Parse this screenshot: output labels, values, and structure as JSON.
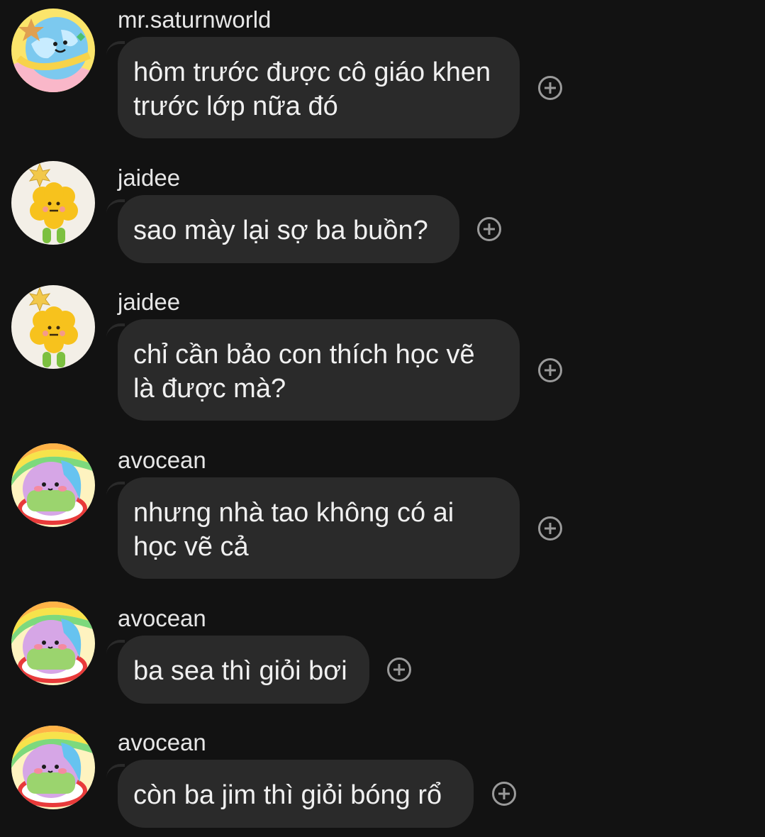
{
  "messages": [
    {
      "username": "mr.saturnworld",
      "text": "hôm trước được cô giáo khen\ntrước lớp nữa đó",
      "avatar": "globe-avatar-icon"
    },
    {
      "username": "jaidee",
      "text": "sao mày lại sợ ba buồn?",
      "avatar": "flower-cookie-avatar-icon"
    },
    {
      "username": "jaidee",
      "text": "chỉ cần bảo con thích học vẽ\nlà được mà?",
      "avatar": "flower-cookie-avatar-icon"
    },
    {
      "username": "avocean",
      "text": "nhưng nhà tao không có ai\nhọc vẽ cả",
      "avatar": "rainbow-blob-avatar-icon"
    },
    {
      "username": "avocean",
      "text": "ba sea thì giỏi bơi",
      "avatar": "rainbow-blob-avatar-icon"
    },
    {
      "username": "avocean",
      "text": "còn ba jim thì giỏi bóng rổ",
      "avatar": "rainbow-blob-avatar-icon"
    }
  ],
  "icons": {
    "add_reaction": "plus-circle-icon"
  },
  "colors": {
    "background": "#121212",
    "bubble": "#2a2a2a",
    "text": "#f0f0f0",
    "icon": "#9a9a9a"
  }
}
